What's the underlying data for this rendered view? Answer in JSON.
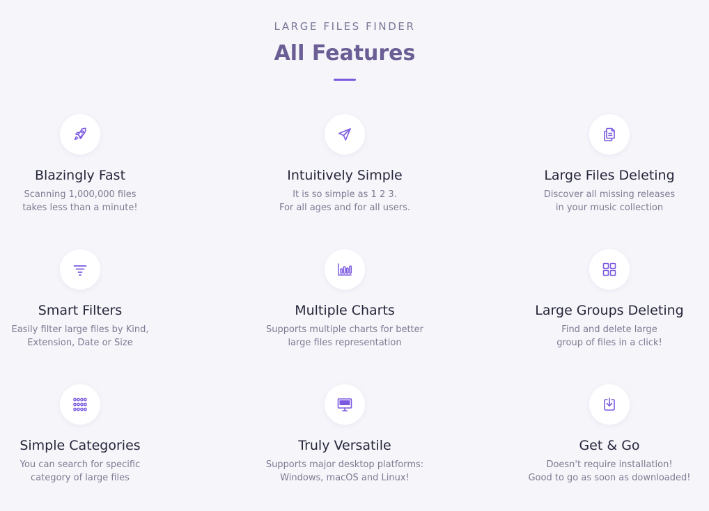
{
  "header": {
    "eyebrow": "LARGE FILES FINDER",
    "title": "All Features"
  },
  "colors": {
    "accent": "#7b5ae0",
    "title": "#6b5e95",
    "background": "#f5f5fa"
  },
  "features": [
    {
      "icon": "rocket-icon",
      "title": "Blazingly Fast",
      "line1": "Scanning 1,000,000 files",
      "line2": "takes less than a minute!"
    },
    {
      "icon": "paper-plane-icon",
      "title": "Intuitively Simple",
      "line1": "It is so simple as 1 2 3.",
      "line2": "For all ages and for all users."
    },
    {
      "icon": "copy-files-icon",
      "title": "Large Files Deleting",
      "line1": "Discover all missing releases",
      "line2": "in your music collection"
    },
    {
      "icon": "filter-icon",
      "title": "Smart Filters",
      "line1": "Easily filter large files by Kind,",
      "line2": "Extension, Date or Size"
    },
    {
      "icon": "bar-chart-icon",
      "title": "Multiple Charts",
      "line1": "Supports multiple charts for better",
      "line2": "large files representation"
    },
    {
      "icon": "grid-icon",
      "title": "Large Groups Deleting",
      "line1": "Find and delete large",
      "line2": "group of files in a click!"
    },
    {
      "icon": "dots-grid-icon",
      "title": "Simple Categories",
      "line1": "You can search for specific",
      "line2": "category of large files"
    },
    {
      "icon": "monitor-icon",
      "title": "Truly Versatile",
      "line1": "Supports major desktop platforms:",
      "line2": "Windows, macOS and Linux!"
    },
    {
      "icon": "download-icon",
      "title": "Get & Go",
      "line1": "Doesn't require installation!",
      "line2": "Good to go as soon as downloaded!"
    }
  ]
}
